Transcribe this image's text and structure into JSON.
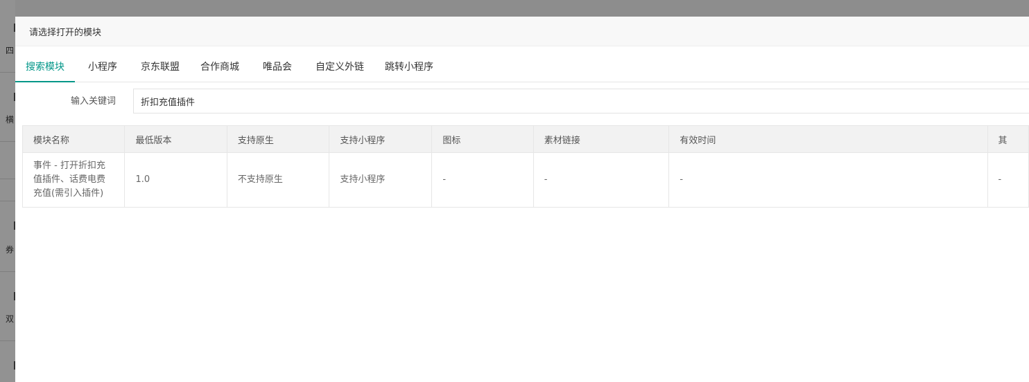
{
  "background": {
    "side_chars": [
      "四",
      "横",
      "券",
      "双"
    ]
  },
  "modal": {
    "title": "请选择打开的模块",
    "tabs": [
      {
        "label": "搜索模块",
        "active": true
      },
      {
        "label": "小程序",
        "active": false
      },
      {
        "label": "京东联盟",
        "active": false
      },
      {
        "label": "合作商城",
        "active": false
      },
      {
        "label": "唯品会",
        "active": false
      },
      {
        "label": "自定义外链",
        "active": false
      },
      {
        "label": "跳转小程序",
        "active": false
      }
    ],
    "search": {
      "label": "输入关键词",
      "value": "折扣充值插件"
    },
    "table": {
      "headers": [
        "模块名称",
        "最低版本",
        "支持原生",
        "支持小程序",
        "图标",
        "素材链接",
        "有效时间",
        "其"
      ],
      "rows": [
        [
          "事件 - 打开折扣充值插件、话费电费充值(需引入插件)",
          "1.0",
          "不支持原生",
          "支持小程序",
          "-",
          "-",
          "-",
          "-"
        ]
      ]
    }
  },
  "colors": {
    "accent": "#009688",
    "header_bg": "#f8f8f8",
    "table_header_bg": "#f2f2f2"
  }
}
